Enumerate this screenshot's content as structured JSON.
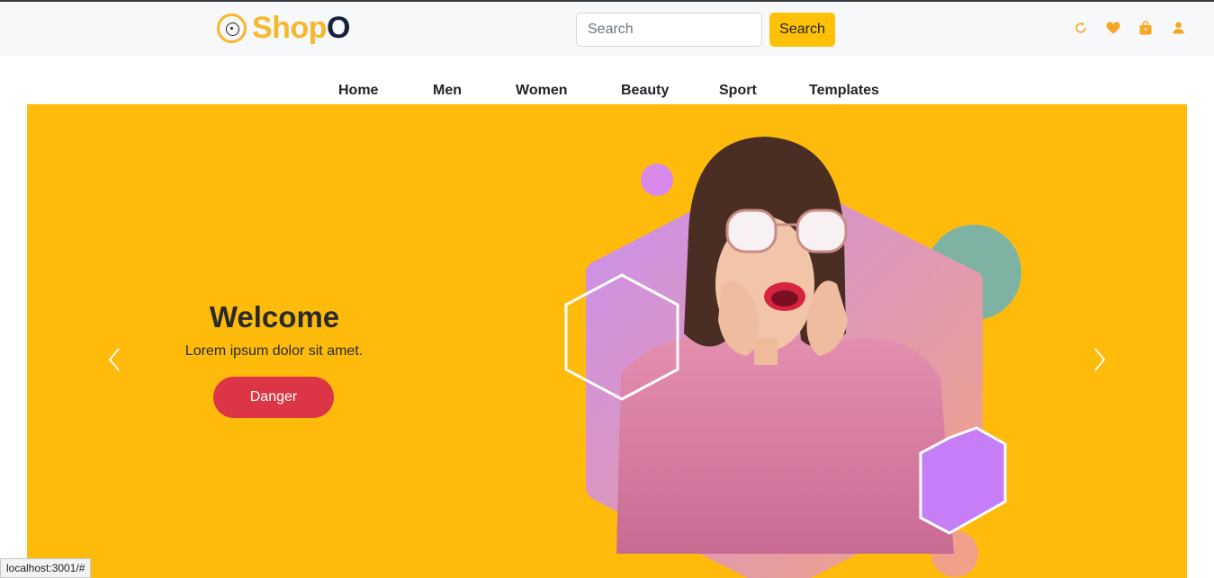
{
  "brand": {
    "name_main": "Shop",
    "name_accent": "O"
  },
  "search": {
    "placeholder": "Search",
    "button_label": "Search"
  },
  "header_icons": [
    "refresh-icon",
    "heart-icon",
    "shopping-bag-icon",
    "user-icon"
  ],
  "nav": {
    "items": [
      {
        "label": "Home"
      },
      {
        "label": "Men"
      },
      {
        "label": "Women"
      },
      {
        "label": "Beauty"
      },
      {
        "label": "Sport"
      },
      {
        "label": "Templates"
      }
    ]
  },
  "hero": {
    "title": "Welcome",
    "subtitle": "Lorem ipsum dolor sit amet.",
    "button_label": "Danger",
    "prev_icon": "chevron-left-icon",
    "next_icon": "chevron-right-icon"
  },
  "status_url": "localhost:3001/#",
  "colors": {
    "accent": "#ffc107",
    "hero_bg": "#ffbb0b",
    "danger": "#dc3545",
    "brand_dark": "#14213d",
    "icon_orange": "#f5a623"
  }
}
